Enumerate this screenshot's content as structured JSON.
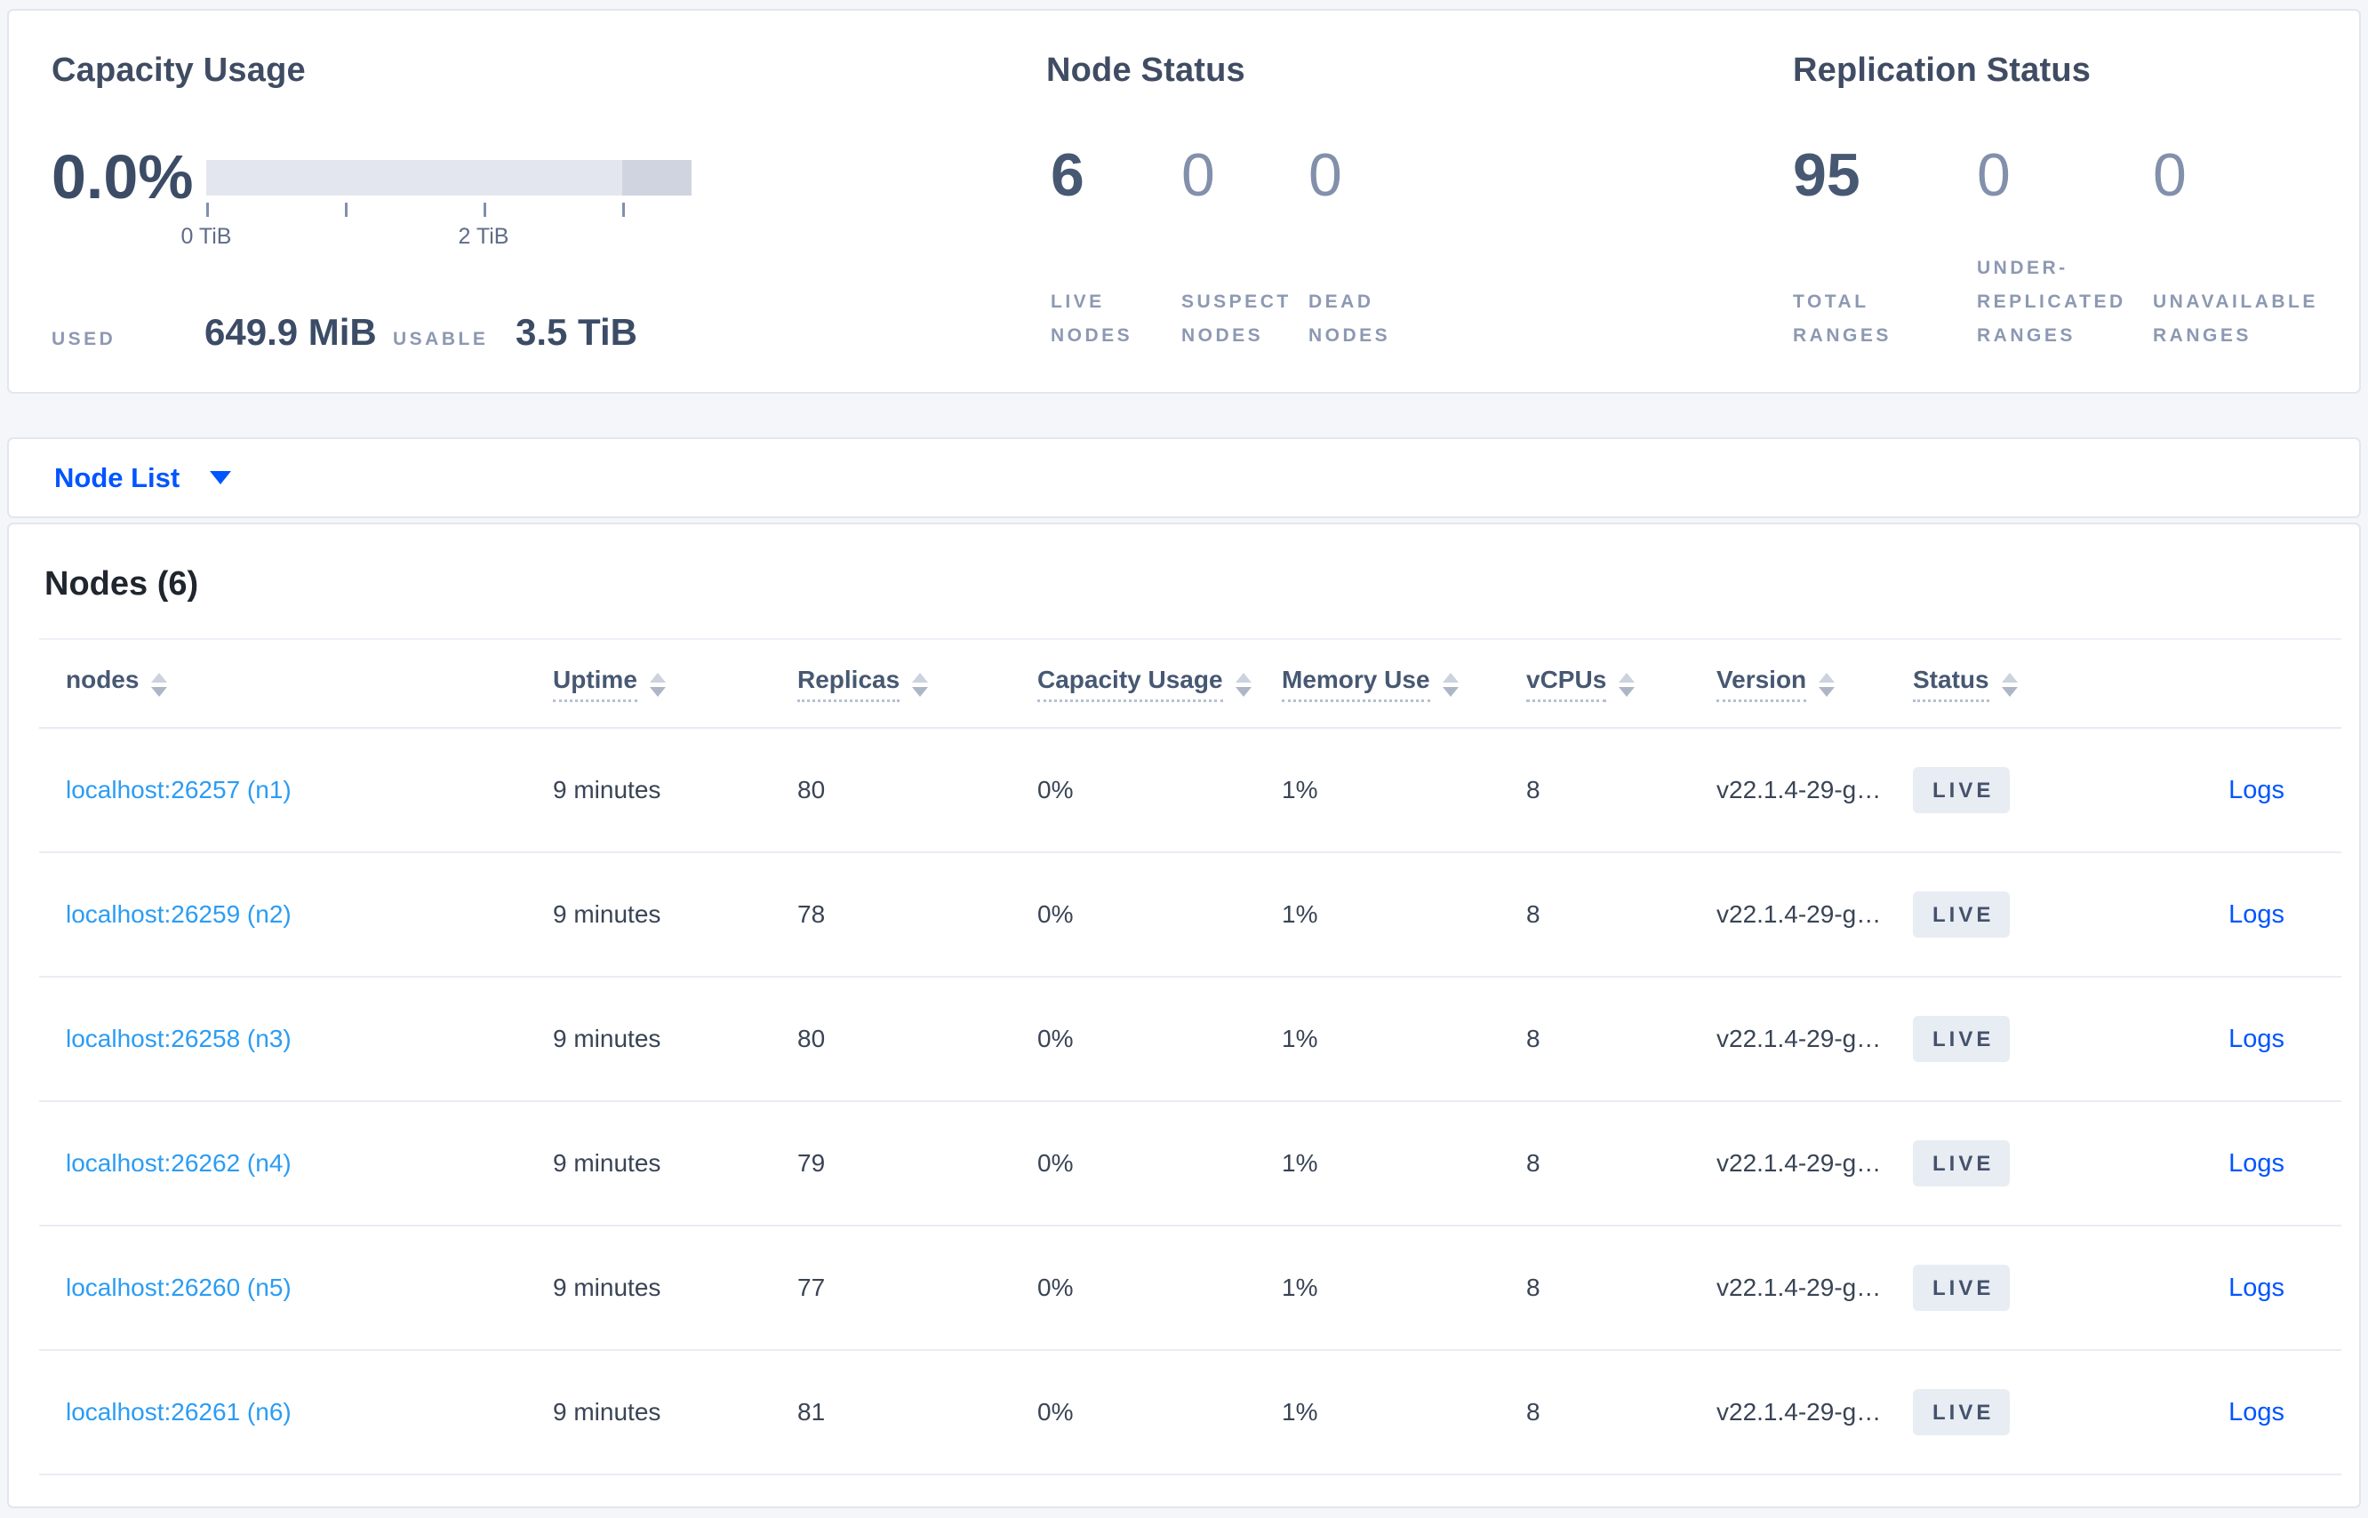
{
  "summary": {
    "capacity_usage": {
      "title": "Capacity Usage",
      "percent": "0.0%",
      "tick_label_0": "0 TiB",
      "tick_label_2": "2 TiB",
      "used_label": "USED",
      "used_value": "649.9 MiB",
      "usable_label": "USABLE",
      "usable_value": "3.5 TiB"
    },
    "node_status": {
      "title": "Node Status",
      "metrics": [
        {
          "value": "6",
          "label": "LIVE NODES",
          "emphasis": true
        },
        {
          "value": "0",
          "label": "SUSPECT NODES",
          "emphasis": false
        },
        {
          "value": "0",
          "label": "DEAD NODES",
          "emphasis": false
        }
      ]
    },
    "replication_status": {
      "title": "Replication Status",
      "metrics": [
        {
          "value": "95",
          "label": "TOTAL RANGES",
          "emphasis": true
        },
        {
          "value": "0",
          "label": "UNDER-REPLICATED RANGES",
          "emphasis": false
        },
        {
          "value": "0",
          "label": "UNAVAILABLE RANGES",
          "emphasis": false
        }
      ]
    }
  },
  "view_selector": {
    "label": "Node List"
  },
  "nodes_table": {
    "title": "Nodes (6)",
    "columns": [
      "nodes",
      "Uptime",
      "Replicas",
      "Capacity Usage",
      "Memory Use",
      "vCPUs",
      "Version",
      "Status"
    ],
    "logs_label": "Logs",
    "rows": [
      {
        "node": "localhost:26257 (n1)",
        "uptime": "9 minutes",
        "replicas": "80",
        "capacity": "0%",
        "memory": "1%",
        "vcpus": "8",
        "version": "v22.1.4-29-g…",
        "status": "LIVE"
      },
      {
        "node": "localhost:26259 (n2)",
        "uptime": "9 minutes",
        "replicas": "78",
        "capacity": "0%",
        "memory": "1%",
        "vcpus": "8",
        "version": "v22.1.4-29-g…",
        "status": "LIVE"
      },
      {
        "node": "localhost:26258 (n3)",
        "uptime": "9 minutes",
        "replicas": "80",
        "capacity": "0%",
        "memory": "1%",
        "vcpus": "8",
        "version": "v22.1.4-29-g…",
        "status": "LIVE"
      },
      {
        "node": "localhost:26262 (n4)",
        "uptime": "9 minutes",
        "replicas": "79",
        "capacity": "0%",
        "memory": "1%",
        "vcpus": "8",
        "version": "v22.1.4-29-g…",
        "status": "LIVE"
      },
      {
        "node": "localhost:26260 (n5)",
        "uptime": "9 minutes",
        "replicas": "77",
        "capacity": "0%",
        "memory": "1%",
        "vcpus": "8",
        "version": "v22.1.4-29-g…",
        "status": "LIVE"
      },
      {
        "node": "localhost:26261 (n6)",
        "uptime": "9 minutes",
        "replicas": "81",
        "capacity": "0%",
        "memory": "1%",
        "vcpus": "8",
        "version": "v22.1.4-29-g…",
        "status": "LIVE"
      }
    ]
  },
  "colors": {
    "accent_blue": "#0055ff",
    "node_link_blue": "#2b9cf4",
    "live_badge_bg": "#e8ecf3",
    "live_badge_text": "#44526b",
    "bar_light": "#e3e6ef",
    "bar_dark": "#cfd4e0"
  }
}
